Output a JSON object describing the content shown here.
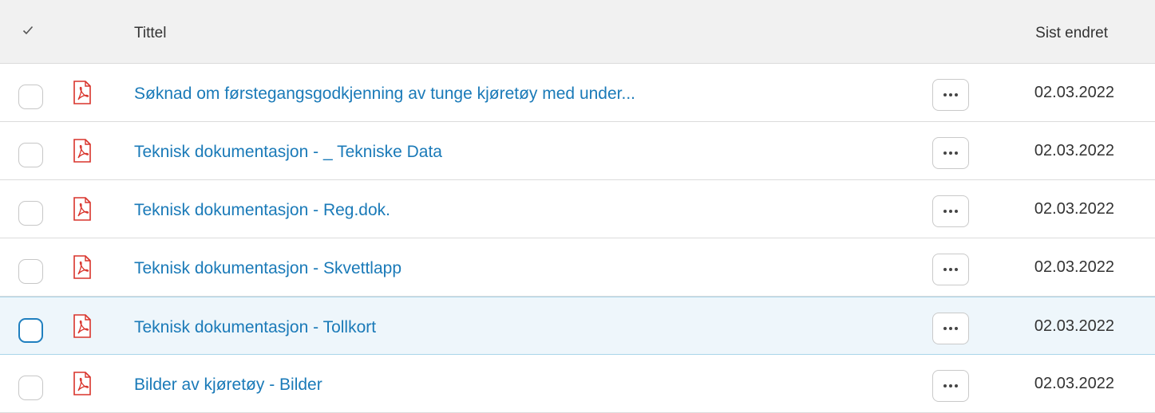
{
  "header": {
    "select_all_icon": "checkmark-icon",
    "title_label": "Tittel",
    "date_label": "Sist endret"
  },
  "rows": [
    {
      "title": "Søknad om førstegangsgodkjenning av tunge kjøretøy med under...",
      "date": "02.03.2022",
      "icon": "pdf-file-icon",
      "highlighted": false
    },
    {
      "title": "Teknisk dokumentasjon - _ Tekniske Data",
      "date": "02.03.2022",
      "icon": "pdf-file-icon",
      "highlighted": false
    },
    {
      "title": "Teknisk dokumentasjon - Reg.dok.",
      "date": "02.03.2022",
      "icon": "pdf-file-icon",
      "highlighted": false
    },
    {
      "title": "Teknisk dokumentasjon - Skvettlapp",
      "date": "02.03.2022",
      "icon": "pdf-file-icon",
      "highlighted": false
    },
    {
      "title": "Teknisk dokumentasjon - Tollkort",
      "date": "02.03.2022",
      "icon": "pdf-file-icon",
      "highlighted": true
    },
    {
      "title": "Bilder av kjøretøy - Bilder",
      "date": "02.03.2022",
      "icon": "pdf-file-icon",
      "highlighted": false
    }
  ],
  "colors": {
    "link": "#1a7ab8",
    "pdf_red": "#d9332b",
    "highlight_bg": "#eef6fb",
    "highlight_border": "#a9d5ea",
    "header_bg": "#f1f1f1"
  }
}
